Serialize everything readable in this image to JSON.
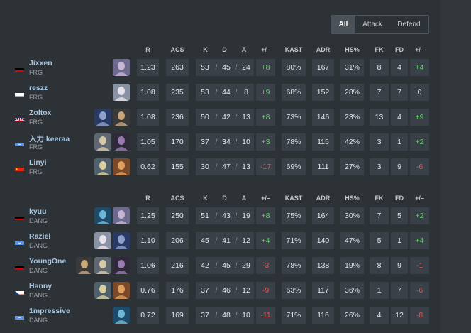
{
  "tabs": [
    {
      "label": "All",
      "active": true
    },
    {
      "label": "Attack",
      "active": false
    },
    {
      "label": "Defend",
      "active": false
    }
  ],
  "headers": {
    "r": "R",
    "acs": "ACS",
    "k": "K",
    "d": "D",
    "a": "A",
    "pm": "+/–",
    "kast": "KAST",
    "adr": "ADR",
    "hs": "HS%",
    "fk": "FK",
    "fd": "FD",
    "fkpm": "+/–"
  },
  "teams": [
    {
      "players": [
        {
          "name": "Jixxen",
          "team": "FRG",
          "flag": "de",
          "agents": [
            "agent"
          ],
          "r": "1.23",
          "acs": "263",
          "k": "53",
          "d": "45",
          "a": "24",
          "pm": "+8",
          "kast": "80%",
          "adr": "167",
          "hs": "31%",
          "fk": "8",
          "fd": "4",
          "fkpm": "+4"
        },
        {
          "name": "reszz",
          "team": "FRG",
          "flag": "pl",
          "agents": [
            "agent"
          ],
          "r": "1.08",
          "acs": "235",
          "k": "53",
          "d": "44",
          "a": "8",
          "pm": "+9",
          "kast": "68%",
          "adr": "152",
          "hs": "28%",
          "fk": "7",
          "fd": "7",
          "fkpm": "0"
        },
        {
          "name": "Zoltox",
          "team": "FRG",
          "flag": "gb",
          "agents": [
            "agent",
            "agent"
          ],
          "r": "1.08",
          "acs": "236",
          "k": "50",
          "d": "42",
          "a": "13",
          "pm": "+8",
          "kast": "73%",
          "adr": "146",
          "hs": "23%",
          "fk": "13",
          "fd": "4",
          "fkpm": "+9"
        },
        {
          "name": "入力 keeraa",
          "team": "FRG",
          "flag": "un",
          "agents": [
            "agent",
            "agent"
          ],
          "r": "1.05",
          "acs": "170",
          "k": "37",
          "d": "34",
          "a": "10",
          "pm": "+3",
          "kast": "78%",
          "adr": "115",
          "hs": "42%",
          "fk": "3",
          "fd": "1",
          "fkpm": "+2"
        },
        {
          "name": "Linyi",
          "team": "FRG",
          "flag": "cn",
          "agents": [
            "agent",
            "agent"
          ],
          "r": "0.62",
          "acs": "155",
          "k": "30",
          "d": "47",
          "a": "13",
          "pm": "-17",
          "kast": "69%",
          "adr": "111",
          "hs": "27%",
          "fk": "3",
          "fd": "9",
          "fkpm": "-6"
        }
      ]
    },
    {
      "players": [
        {
          "name": "kyuu",
          "team": "DANG",
          "flag": "de",
          "agents": [
            "agent",
            "agent"
          ],
          "r": "1.25",
          "acs": "250",
          "k": "51",
          "d": "43",
          "a": "19",
          "pm": "+8",
          "kast": "75%",
          "adr": "164",
          "hs": "30%",
          "fk": "7",
          "fd": "5",
          "fkpm": "+2"
        },
        {
          "name": "Raziel",
          "team": "DANG",
          "flag": "un",
          "agents": [
            "agent",
            "agent"
          ],
          "r": "1.10",
          "acs": "206",
          "k": "45",
          "d": "41",
          "a": "12",
          "pm": "+4",
          "kast": "71%",
          "adr": "140",
          "hs": "47%",
          "fk": "5",
          "fd": "1",
          "fkpm": "+4"
        },
        {
          "name": "YoungOne",
          "team": "DANG",
          "flag": "de",
          "agents": [
            "agent",
            "agent",
            "agent"
          ],
          "r": "1.06",
          "acs": "216",
          "k": "42",
          "d": "45",
          "a": "29",
          "pm": "-3",
          "kast": "78%",
          "adr": "138",
          "hs": "19%",
          "fk": "8",
          "fd": "9",
          "fkpm": "-1"
        },
        {
          "name": "Hanny",
          "team": "DANG",
          "flag": "cz",
          "agents": [
            "agent",
            "agent"
          ],
          "r": "0.76",
          "acs": "176",
          "k": "37",
          "d": "46",
          "a": "12",
          "pm": "-9",
          "kast": "63%",
          "adr": "117",
          "hs": "36%",
          "fk": "1",
          "fd": "7",
          "fkpm": "-6"
        },
        {
          "name": "1mpressive",
          "team": "DANG",
          "flag": "un",
          "agents": [
            "agent"
          ],
          "r": "0.72",
          "acs": "169",
          "k": "37",
          "d": "48",
          "a": "10",
          "pm": "-11",
          "kast": "71%",
          "adr": "116",
          "hs": "26%",
          "fk": "4",
          "fd": "12",
          "fkpm": "-8"
        }
      ]
    }
  ],
  "colors": {
    "positive": "#5fcf68",
    "negative": "#ef5350",
    "name": "#a6c5e0",
    "cell": "#3a4047"
  }
}
